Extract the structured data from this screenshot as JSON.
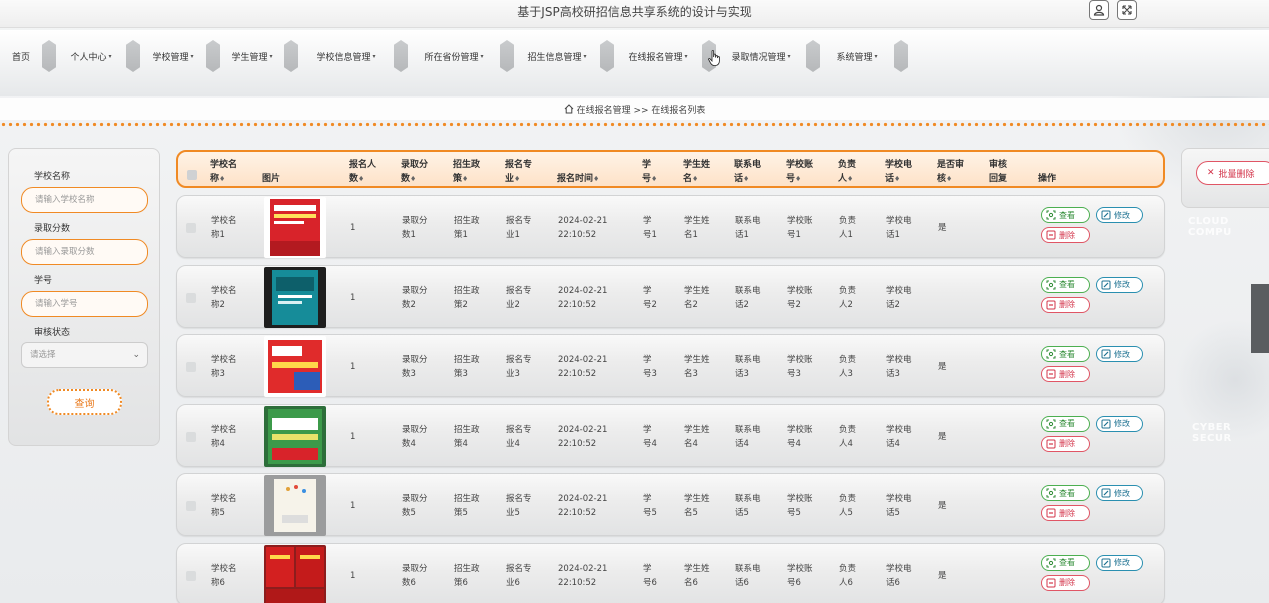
{
  "app": {
    "title": "基于JSP高校研招信息共享系统的设计与实现"
  },
  "nav": {
    "items": [
      {
        "label": "首页",
        "caret": ""
      },
      {
        "label": "个人中心",
        "caret": "▾"
      },
      {
        "label": "学校管理",
        "caret": "▾"
      },
      {
        "label": "学生管理",
        "caret": "▾"
      },
      {
        "label": "学校信息管理",
        "caret": "▾"
      },
      {
        "label": "所在省份管理",
        "caret": "▾"
      },
      {
        "label": "招生信息管理",
        "caret": "▾"
      },
      {
        "label": "在线报名管理",
        "caret": "▾"
      },
      {
        "label": "录取情况管理",
        "caret": "▾"
      },
      {
        "label": "系统管理",
        "caret": "▾"
      }
    ]
  },
  "breadcrumb": {
    "path": "在线报名管理 >> 在线报名列表"
  },
  "search": {
    "school_label": "学校名称",
    "school_placeholder": "请输入学校名称",
    "score_label": "录取分数",
    "score_placeholder": "请输入录取分数",
    "id_label": "学号",
    "id_placeholder": "请输入学号",
    "status_label": "审核状态",
    "status_value": "请选择",
    "query_label": "查询"
  },
  "toolbar": {
    "batch_delete": "批量删除"
  },
  "deco": {
    "text1": "CLOUD COMPU",
    "text2": "CYBER SECUR"
  },
  "table": {
    "headers": [
      {
        "l1": "学校名",
        "l2": "称",
        "sort": "♦"
      },
      {
        "l1": "",
        "l2": "图片",
        "sort": ""
      },
      {
        "l1": "报名人",
        "l2": "数",
        "sort": "♦"
      },
      {
        "l1": "录取分",
        "l2": "数",
        "sort": "♦"
      },
      {
        "l1": "招生政",
        "l2": "策",
        "sort": "♦"
      },
      {
        "l1": "报名专",
        "l2": "业",
        "sort": "♦"
      },
      {
        "l1": "",
        "l2": "报名时间",
        "sort": "♦"
      },
      {
        "l1": "学",
        "l2": "号",
        "sort": "♦"
      },
      {
        "l1": "学生姓",
        "l2": "名",
        "sort": "♦"
      },
      {
        "l1": "联系电",
        "l2": "话",
        "sort": "♦"
      },
      {
        "l1": "学校账",
        "l2": "号",
        "sort": "♦"
      },
      {
        "l1": "负责",
        "l2": "人",
        "sort": "♦"
      },
      {
        "l1": "学校电",
        "l2": "话",
        "sort": "♦"
      },
      {
        "l1": "是否审",
        "l2": "核",
        "sort": "♦"
      },
      {
        "l1": "审核",
        "l2": "回复",
        "sort": ""
      },
      {
        "l1": "",
        "l2": "操作",
        "sort": ""
      }
    ],
    "rows": [
      {
        "school": [
          "学校名",
          "称1"
        ],
        "count": "1",
        "score": [
          "录取分",
          "数1"
        ],
        "policy": [
          "招生政",
          "策1"
        ],
        "major": [
          "报名专",
          "业1"
        ],
        "date": [
          "2024-02-21",
          "22:10:52"
        ],
        "sid": [
          "学",
          "号1"
        ],
        "sname": [
          "学生姓",
          "名1"
        ],
        "phone": [
          "联系电",
          "话1"
        ],
        "account": [
          "学校账",
          "号1"
        ],
        "owner": [
          "负责",
          "人1"
        ],
        "sphone": [
          "学校电",
          "话1"
        ],
        "approved": "是",
        "img": "red"
      },
      {
        "school": [
          "学校名",
          "称2"
        ],
        "count": "1",
        "score": [
          "录取分",
          "数2"
        ],
        "policy": [
          "招生政",
          "策2"
        ],
        "major": [
          "报名专",
          "业2"
        ],
        "date": [
          "2024-02-21",
          "22:10:52"
        ],
        "sid": [
          "学",
          "号2"
        ],
        "sname": [
          "学生姓",
          "名2"
        ],
        "phone": [
          "联系电",
          "话2"
        ],
        "account": [
          "学校账",
          "号2"
        ],
        "owner": [
          "负责",
          "人2"
        ],
        "sphone": [
          "学校电",
          "话2"
        ],
        "approved": "",
        "img": "teal"
      },
      {
        "school": [
          "学校名",
          "称3"
        ],
        "count": "1",
        "score": [
          "录取分",
          "数3"
        ],
        "policy": [
          "招生政",
          "策3"
        ],
        "major": [
          "报名专",
          "业3"
        ],
        "date": [
          "2024-02-21",
          "22:10:52"
        ],
        "sid": [
          "学",
          "号3"
        ],
        "sname": [
          "学生姓",
          "名3"
        ],
        "phone": [
          "联系电",
          "话3"
        ],
        "account": [
          "学校账",
          "号3"
        ],
        "owner": [
          "负责",
          "人3"
        ],
        "sphone": [
          "学校电",
          "话3"
        ],
        "approved": "是",
        "img": "english"
      },
      {
        "school": [
          "学校名",
          "称4"
        ],
        "count": "1",
        "score": [
          "录取分",
          "数4"
        ],
        "policy": [
          "招生政",
          "策4"
        ],
        "major": [
          "报名专",
          "业4"
        ],
        "date": [
          "2024-02-21",
          "22:10:52"
        ],
        "sid": [
          "学",
          "号4"
        ],
        "sname": [
          "学生姓",
          "名4"
        ],
        "phone": [
          "联系电",
          "话4"
        ],
        "account": [
          "学校账",
          "号4"
        ],
        "owner": [
          "负责",
          "人4"
        ],
        "sphone": [
          "学校电",
          "话4"
        ],
        "approved": "是",
        "img": "green"
      },
      {
        "school": [
          "学校名",
          "称5"
        ],
        "count": "1",
        "score": [
          "录取分",
          "数5"
        ],
        "policy": [
          "招生政",
          "策5"
        ],
        "major": [
          "报名专",
          "业5"
        ],
        "date": [
          "2024-02-21",
          "22:10:52"
        ],
        "sid": [
          "学",
          "号5"
        ],
        "sname": [
          "学生姓",
          "名5"
        ],
        "phone": [
          "联系电",
          "话5"
        ],
        "account": [
          "学校账",
          "号5"
        ],
        "owner": [
          "负责",
          "人5"
        ],
        "sphone": [
          "学校电",
          "话5"
        ],
        "approved": "是",
        "img": "white"
      },
      {
        "school": [
          "学校名",
          "称6"
        ],
        "count": "1",
        "score": [
          "录取分",
          "数6"
        ],
        "policy": [
          "招生政",
          "策6"
        ],
        "major": [
          "报名专",
          "业6"
        ],
        "date": [
          "2024-02-21",
          "22:10:52"
        ],
        "sid": [
          "学",
          "号6"
        ],
        "sname": [
          "学生姓",
          "名6"
        ],
        "phone": [
          "联系电",
          "话6"
        ],
        "account": [
          "学校账",
          "号6"
        ],
        "owner": [
          "负责",
          "人6"
        ],
        "sphone": [
          "学校电",
          "话6"
        ],
        "approved": "是",
        "img": "redbooks"
      }
    ],
    "ops": {
      "view": "查看",
      "edit": "修改",
      "del": "删除"
    }
  },
  "colors": {
    "accent": "#f08a24",
    "danger": "#d3344a",
    "success": "#2e8b34",
    "info": "#1d7191"
  }
}
